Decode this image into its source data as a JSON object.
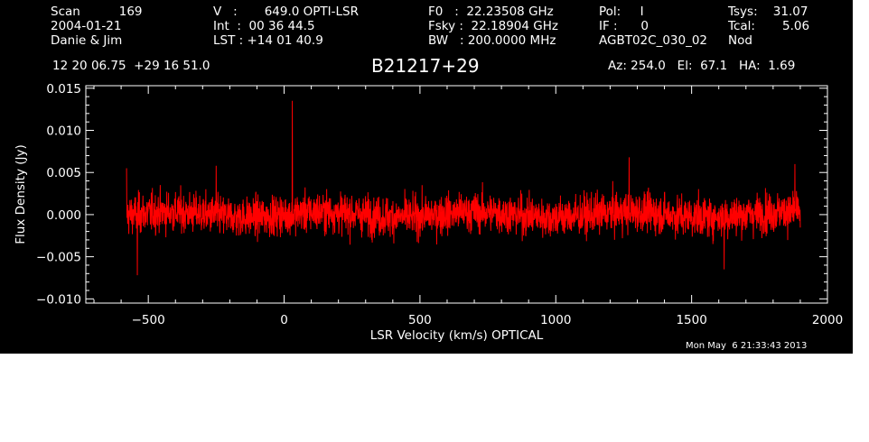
{
  "header": {
    "col1": {
      "row1": "Scan          169",
      "row2": "2004-01-21",
      "row3": "Danie & Jim"
    },
    "col2": {
      "row1": "V   :       649.0 OPTI-LSR",
      "row2": "Int  :  00 36 44.5",
      "row3": "LST : +14 01 40.9"
    },
    "col3": {
      "row1": "F0   :  22.23508 GHz",
      "row2": "Fsky :  22.18904 GHz",
      "row3": "BW   : 200.0000 MHz"
    },
    "col4": {
      "row1": "Pol:     I",
      "row2": "IF :      0",
      "row3": "AGBT02C_030_02"
    },
    "col5": {
      "row1": "Tsys:    31.07",
      "row2": "Tcal:       5.06",
      "row3": "Nod"
    },
    "coords": "12 20 06.75  +29 16 51.0",
    "source": "B21217+29",
    "azel": "Az: 254.0   El:  67.1   HA:  1.69"
  },
  "timestamp": "Mon May  6 21:33:43 2013",
  "colors": {
    "background": "#000000",
    "axes": "#ffffff",
    "trace": "#ff0000"
  },
  "chart_data": {
    "type": "line",
    "title": "B21217+29",
    "xlabel": "LSR Velocity (km/s) OPTICAL",
    "ylabel": "Flux Density (Jy)",
    "xlim": [
      -730,
      2000
    ],
    "ylim": [
      -0.0105,
      0.0153
    ],
    "xticks": [
      -500,
      0,
      500,
      1000,
      1500,
      2000
    ],
    "xtick_labels": [
      "−500",
      "0",
      "500",
      "1000",
      "1500",
      "2000"
    ],
    "yticks": [
      -0.01,
      -0.005,
      0.0,
      0.005,
      0.01,
      0.015
    ],
    "ytick_labels": [
      "−0.010",
      "−0.005",
      "0.000",
      "0.005",
      "0.010",
      "0.015"
    ],
    "grid": false,
    "series": [
      {
        "color": "#ff0000",
        "x_range": [
          -580,
          1900
        ],
        "rms": 0.0022,
        "peaks": [
          {
            "x": 30,
            "y": 0.0135
          },
          {
            "x": -250,
            "y": 0.0058
          },
          {
            "x": -580,
            "y": 0.0055
          },
          {
            "x": 1270,
            "y": 0.0068
          },
          {
            "x": 1880,
            "y": 0.006
          },
          {
            "x": -540,
            "y": -0.0072
          },
          {
            "x": 1620,
            "y": -0.0065
          }
        ]
      }
    ]
  }
}
